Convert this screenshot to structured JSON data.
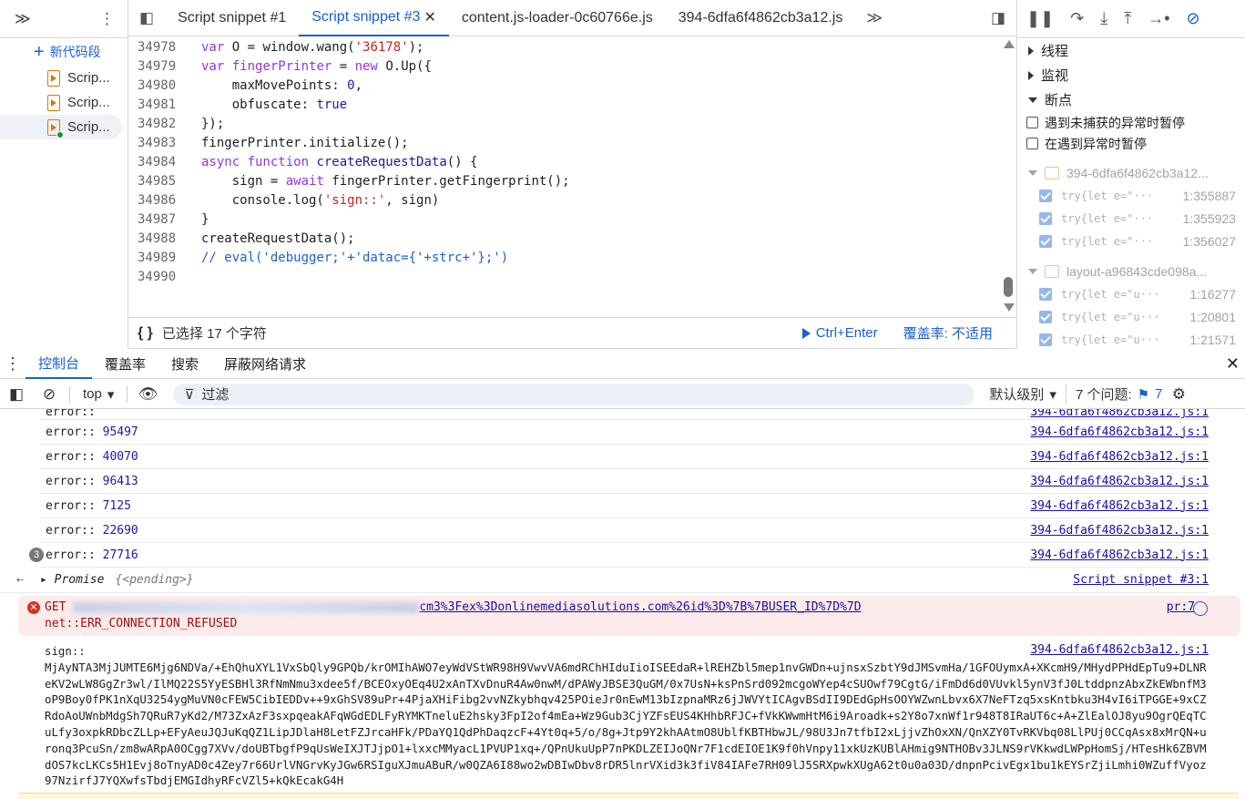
{
  "left": {
    "new_label": "新代码段",
    "snippets": [
      "Scrip...",
      "Scrip...",
      "Scrip..."
    ]
  },
  "tabs": [
    "Script snippet #1",
    "Script snippet #3",
    "content.js-loader-0c60766e.js",
    "394-6dfa6f4862cb3a12.js"
  ],
  "active_tab": 1,
  "code": [
    {
      "no": "34978",
      "html": "<span class=\"kw\">var</span> O = window.wang(<span class=\"str\">'36178'</span>);"
    },
    {
      "no": "34979",
      "html": "<span class=\"kw\">var</span> <span class=\"vr\">fingerPrinter</span> = <span class=\"kw\">new</span> O.Up({"
    },
    {
      "no": "34980",
      "html": "    maxMovePoints: <span class=\"num\">0</span>,"
    },
    {
      "no": "34981",
      "html": "    obfuscate: <span class=\"fn\">true</span>"
    },
    {
      "no": "34982",
      "html": "});"
    },
    {
      "no": "34983",
      "html": "fingerPrinter.initialize();"
    },
    {
      "no": "34984",
      "html": "<span class=\"kw\">async function</span> <span class=\"fn\">createRequestData</span>() {"
    },
    {
      "no": "34985",
      "html": "    sign = <span class=\"kw\">await</span> fingerPrinter.getFingerprint();"
    },
    {
      "no": "34986",
      "html": "    console.log(<span class=\"str\">'sign::'</span>, sign)"
    },
    {
      "no": "34987",
      "html": "}"
    },
    {
      "no": "34988",
      "html": "createRequestData();"
    },
    {
      "no": "34989",
      "html": "<span class=\"cm\">// eval('debugger;'+'datac={'+strc+'};')</span>"
    },
    {
      "no": "34990",
      "html": ""
    }
  ],
  "editor_status": {
    "braces": "{ }",
    "selection": "已选择 17 个字符",
    "run": "Ctrl+Enter",
    "coverage": "覆盖率: 不适用"
  },
  "right": {
    "sections": [
      "线程",
      "监视",
      "断点"
    ],
    "checks": [
      "遇到未捕获的异常时暂停",
      "在遇到异常时暂停"
    ],
    "bp_groups": [
      {
        "file": "394-6dfa6f4862cb3a12...",
        "items": [
          {
            "code": "try{let e=\"···",
            "loc": "1:355887"
          },
          {
            "code": "try{let e=\"···",
            "loc": "1:355923"
          },
          {
            "code": "try{let e=\"···",
            "loc": "1:356027"
          }
        ]
      },
      {
        "file": "layout-a96843cde098a...",
        "items": [
          {
            "code": "try{let e=\"u···",
            "loc": "1:16277"
          },
          {
            "code": "try{let e=\"u···",
            "loc": "1:20801"
          },
          {
            "code": "try{let e=\"u···",
            "loc": "1:21571"
          }
        ]
      }
    ]
  },
  "drawer_tabs": [
    "控制台",
    "覆盖率",
    "搜索",
    "屏蔽网络请求"
  ],
  "console_toolbar": {
    "context": "top",
    "filter_placeholder": "过滤",
    "level": "默认级别",
    "issues": "7 个问题:",
    "issue_count": "7"
  },
  "console": {
    "errors": [
      {
        "label": "error::",
        "value": "95497",
        "src": "394-6dfa6f4862cb3a12.js:1"
      },
      {
        "label": "error::",
        "value": "40070",
        "src": "394-6dfa6f4862cb3a12.js:1"
      },
      {
        "label": "error::",
        "value": "96413",
        "src": "394-6dfa6f4862cb3a12.js:1"
      },
      {
        "label": "error::",
        "value": "7125",
        "src": "394-6dfa6f4862cb3a12.js:1"
      },
      {
        "label": "error::",
        "value": "22690",
        "src": "394-6dfa6f4862cb3a12.js:1"
      },
      {
        "label": "error::",
        "value": "27716",
        "src": "394-6dfa6f4862cb3a12.js:1",
        "count": "3"
      }
    ],
    "promise": {
      "label": "Promise",
      "state": "{<pending>}",
      "src": "Script snippet #3:1"
    },
    "get_error": {
      "method": "GET",
      "url_tail": "cm3%3Fex%3Donlinemediasolutions.com%26id%3D%7B%7BUSER_ID%7D%7D",
      "detail": "net::ERR_CONNECTION_REFUSED",
      "src": "pr:7"
    },
    "sign": {
      "label": "sign::",
      "src": "394-6dfa6f4862cb3a12.js:1",
      "value": "MjAyNTA3MjJUMTE6Mjg6NDVa/+EhQhuXYL1VxSbQly9GPQb/krOMIhAWO7eyWdVStWR98H9VwvVA6mdRChHIduIioISEEdaR+lREHZbl5mep1nvGWDn+ujnsxSzbtY9dJMSvmHa/1GFOUymxA+XKcmH9/MHydPPHdEpTu9+DLNReKV2wLW8GgZr3wl/IlMQ22S5YyESBHl3RfNmNmu3xdee5f/BCEOxyOEq4U2xAnTXvDnuR4Aw0nwM/dPAWyJBSE3QuGM/0x7UsN+ksPnSrd092mcgoWYep4cSUOwf79CgtG/iFmDd6d0VUvkl5ynV3fJ0LtddpnzAbxZkEWbnfM3oP9Boy0fPK1nXqU3254ygMuVN0cFEW5CibIEDDv++9xGhSV89uPr+4PjaXHiFibg2vvNZkybhqv425POieJr0nEwM13bIzpnaMRz6jJWVYtICAgvBSdII9DEdGpHsOOYWZwnLbvx6X7NeFTzq5xsKntbku3H4vI6iTPGGE+9xCZRdoAoUWnbMdgSh7QRuR7yKd2/M73ZxAzF3sxpqeakAFqWGdEDLFyRYMKTneluE2hsky3FpI2of4mEa+Wz9Gub3CjYZFsEUS4KHhbRFJC+fVkKWwmHtM6i9Aroadk+s2Y8o7xnWf1r948T8IRaUT6c+A+ZlEalOJ8yu9OgrQEqTCuLfy3oxpkRDbcZLLp+EFyAeuJQJuKqQZ1LipJDlaH8LetFZJrcaHFk/PDaYQ1QdPhDaqzcF+4Yt0q+5/o/8g+Jtp9Y2khAAtmO8UblfKBTHbwJL/98U3Jn7tfbI2xLjjvZhOxXN/QnXZY0TvRKVbq08LlPUj0CCqAsx8xMrQN+uronq3PcuSn/zm8wARpA0OCgg7XVv/doUBTbgfP9qUsWeIXJTJjpO1+lxxcMMyacL1PVUP1xq+/QPnUkuUpP7nPKDLZEIJoQNr7F1cdEIOE1K9f0hVnpy11xkUzKUBlAHmig9NTHOBv3JLNS9rVKkwdLWPpHomSj/HTesHk6ZBVMdOS7kcLKCs5H1Evj8oTnyAD0c4Zey7r66UrlVNGrvKyJGw6RSIguXJmuABuR/w0QZA6I88wo2wDBIwDbv8rDR5lnrVXid3k3fiV84IAFe7RH09lJ5SRXpwkXUgA62t0u0a03D/dnpnPcivEgx1bu1kEYSrZjiLmhi0WZuffVyoz97NzirfJ7YQXwfsTbdjEMGIdhyRFcVZl5+kQkEcakG4H"
    }
  }
}
